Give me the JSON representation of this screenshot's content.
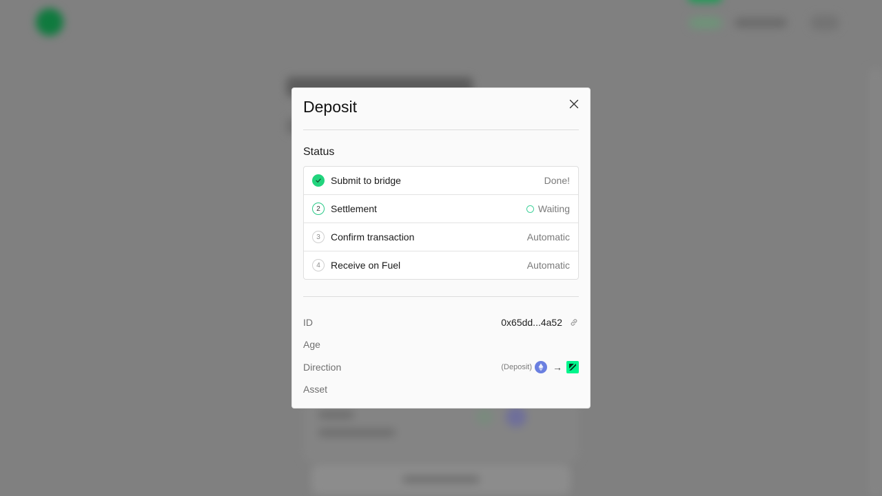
{
  "modal": {
    "title": "Deposit",
    "close_icon": "close-icon",
    "status_heading": "Status",
    "steps": [
      {
        "number": "",
        "label": "Submit to bridge",
        "status": "Done!",
        "state": "done",
        "icon": "check-icon"
      },
      {
        "number": "2",
        "label": "Settlement",
        "status": "Waiting",
        "state": "active",
        "icon": "spinner-icon"
      },
      {
        "number": "3",
        "label": "Confirm transaction",
        "status": "Automatic",
        "state": "pending"
      },
      {
        "number": "4",
        "label": "Receive on Fuel",
        "status": "Automatic",
        "state": "pending"
      }
    ],
    "details": {
      "id_label": "ID",
      "id_value": "0x65dd...4a52",
      "id_icon": "link-icon",
      "age_label": "Age",
      "direction_label": "Direction",
      "direction_tag": "(Deposit)",
      "direction_from_icon": "ethereum-icon",
      "direction_arrow": "→",
      "direction_to_icon": "fuel-icon",
      "asset_label": "Asset"
    }
  },
  "colors": {
    "overlay": "#808080",
    "accent_green": "#22d47d",
    "fuel_green": "#00f58c",
    "ethereum_blue": "#6a7fe0"
  }
}
